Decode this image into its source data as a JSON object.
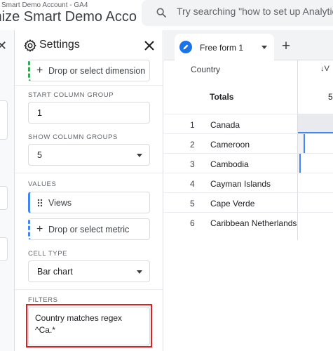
{
  "header": {
    "account_line": "Smart Demo Account - GA4",
    "title": "mize Smart Demo Acco",
    "search_placeholder": "Try searching \"how to set up Analytics"
  },
  "settings": {
    "title": "Settings",
    "dimension_drop": "Drop or select dimension",
    "start_column_group": {
      "label": "START COLUMN GROUP",
      "value": "1"
    },
    "show_column_groups": {
      "label": "SHOW COLUMN GROUPS",
      "value": "5"
    },
    "values": {
      "label": "VALUES",
      "metric": "Views",
      "metric_drop": "Drop or select metric"
    },
    "cell_type": {
      "label": "CELL TYPE",
      "value": "Bar chart"
    },
    "filters": {
      "label": "FILTERS",
      "text": "Country matches regex\n^Ca.*"
    }
  },
  "report": {
    "tab_label": "Free form 1",
    "table": {
      "dimension_header": "Country",
      "metric_header": "↓V",
      "totals_label": "Totals",
      "totals_value": "5",
      "rows": [
        {
          "index": "1",
          "name": "Canada",
          "bar_fraction": 1.0
        },
        {
          "index": "2",
          "name": "Cameroon",
          "bar_fraction": 0.2
        },
        {
          "index": "3",
          "name": "Cambodia",
          "bar_fraction": 0.08
        },
        {
          "index": "4",
          "name": "Cayman Islands",
          "bar_fraction": 0
        },
        {
          "index": "5",
          "name": "Cape Verde",
          "bar_fraction": 0
        },
        {
          "index": "6",
          "name": "Caribbean Netherlands",
          "bar_fraction": 0
        }
      ]
    }
  },
  "colors": {
    "accent_blue": "#1a73e8",
    "bar_blue": "#4285f4",
    "dimension_green": "#34a853",
    "highlight_red": "#e02020"
  },
  "icons": {
    "search": "search-icon",
    "gear": "gear-icon",
    "close": "close-icon",
    "tab_edit": "pencil-icon",
    "add_tab": "plus-icon",
    "drag": "drag-handle-icon",
    "dropdown": "chevron-down-icon"
  }
}
